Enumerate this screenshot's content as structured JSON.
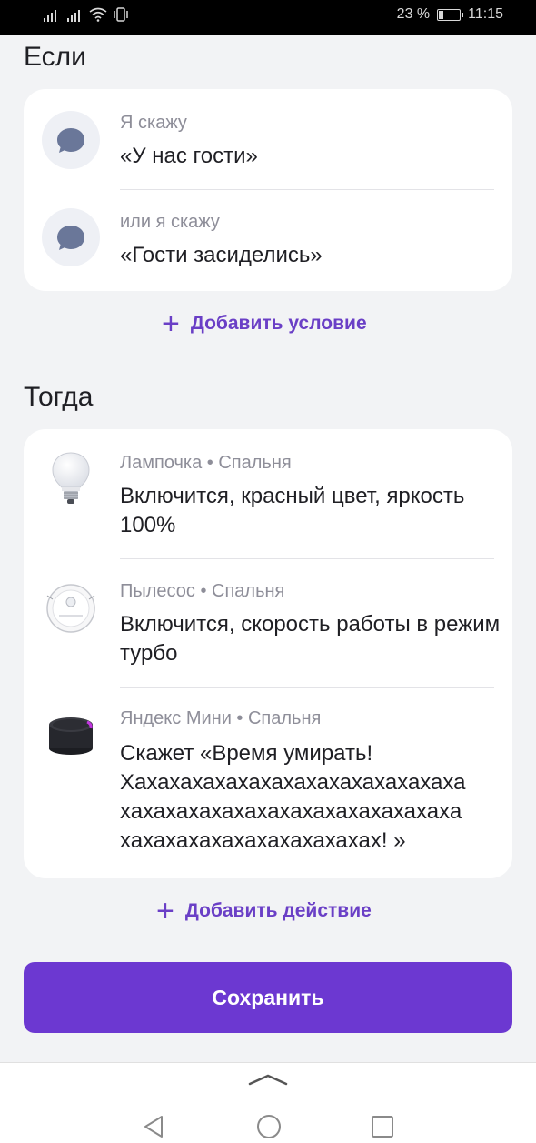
{
  "status_bar": {
    "battery_percent": "23 %",
    "battery_level": 0.23,
    "time": "11:15",
    "signal_icons": [
      "signal-icon",
      "signal-icon",
      "wifi-icon",
      "vibrate-icon"
    ]
  },
  "if_section": {
    "title": "Если",
    "conditions": [
      {
        "label": "Я скажу",
        "phrase": "«У нас гости»",
        "icon": "chat-bubble-icon"
      },
      {
        "label": "или я скажу",
        "phrase": "«Гости засиделись»",
        "icon": "chat-bubble-icon"
      }
    ],
    "add_label": "Добавить условие"
  },
  "then_section": {
    "title": "Тогда",
    "actions": [
      {
        "label": "Лампочка • Спальня",
        "text": "Включится, красный цвет, яркость 100%",
        "icon": "lightbulb-icon"
      },
      {
        "label": "Пылесос • Спальня",
        "text": "Включится, скорость работы в режим турбо",
        "icon": "robot-vacuum-icon"
      },
      {
        "label": "Яндекс Мини • Спальня",
        "text": "Скажет «Время умирать! Хахахахахахахахахахахахахахаха хахахахахахахахахахахахахахаха хахахахахахахахахахахах! »",
        "icon": "smart-speaker-icon"
      }
    ],
    "add_label": "Добавить действие"
  },
  "save_button": "Сохранить",
  "colors": {
    "accent": "#6c38d1",
    "link": "#6a3fc6",
    "background": "#f2f3f5",
    "card": "#ffffff"
  },
  "nav_icons": [
    "chevron-up-icon",
    "back-icon",
    "home-icon",
    "recents-icon"
  ]
}
